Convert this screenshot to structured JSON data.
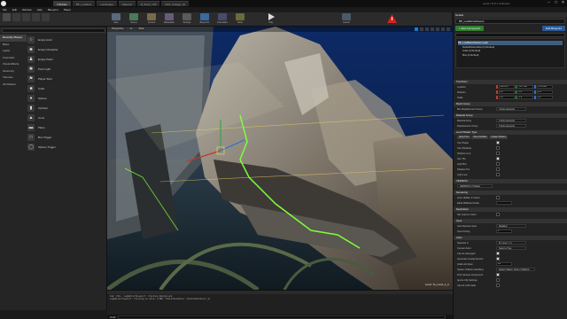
{
  "window": {
    "tabs": [
      "CiffyMap",
      "BP_LostRuin",
      "Landscape",
      "Material",
      "M_Rock_Cliff",
      "MAT_Foliage_02"
    ],
    "title": "Level | TLV x Unknown",
    "controls": [
      "–",
      "□",
      "✕"
    ]
  },
  "menu": [
    "File",
    "Edit",
    "Window",
    "Help",
    "Blueprint",
    "Player"
  ],
  "toolbar": {
    "labels": [
      "Save",
      "Source",
      "Content",
      "Marketplace",
      "Settings",
      "Blueprints",
      "Cinematics",
      "Build",
      "Play",
      "Launch"
    ],
    "accent": "#1f7acb",
    "warning_color": "#d42020"
  },
  "modes": {
    "categories": [
      "Recently Placed",
      "Basic",
      "Lights",
      "Cinematic",
      "Visual Effects",
      "Geometry",
      "Volumes",
      "All Classes"
    ],
    "active_category_index": 0,
    "items": [
      "Empty Actor",
      "Empty Character",
      "Empty Pawn",
      "Point Light",
      "Player Start",
      "Cube",
      "Sphere",
      "Cylinder",
      "Cone",
      "Plane",
      "Box Trigger",
      "Sphere Trigger"
    ]
  },
  "viewport": {
    "top_chips": [
      "Perspective",
      "Lit",
      "Show"
    ],
    "level_label": "Level: SI_Level_1_b"
  },
  "content_browser": {
    "log_lines": [
      "Cmd: FILL…   LogEditorViewport: Clicking Background",
      "LogEditorViewport: Clicking on Actor (LMB): StaticMeshActor (StaticMeshActor_1)"
    ],
    "cmd_label": "Cmd"
  },
  "details": {
    "tab_label": "Details",
    "selected_name": "BP_LostRuinsTowers",
    "add_component": "+ Add Component",
    "edit_blueprint": "Edit Blueprint",
    "components": [
      {
        "label": "BP_LostRuinsTowers (self)",
        "selected": true,
        "indent": false
      },
      {
        "label": "DefaultSceneRoot (Inherited)",
        "selected": false,
        "indent": true
      },
      {
        "label": "Cube (Inherited)",
        "selected": false,
        "indent": true
      },
      {
        "label": "Box (Inherited)",
        "selected": false,
        "indent": true
      }
    ],
    "transform": {
      "header": "Transform",
      "rows": [
        {
          "label": "Location",
          "x": "1026.437",
          "y": "1157.907",
          "z": "1730.000"
        },
        {
          "label": "Rotation",
          "x": "0.0°",
          "y": "0.0°",
          "z": "0.0°"
        },
        {
          "label": "Scale",
          "x": "1.0",
          "y": "1.0",
          "z": "1.0"
        }
      ]
    },
    "sections": [
      {
        "header": "Mesh Group",
        "rows": [
          {
            "label": "Box Replacement Group",
            "value": "3 Array elements"
          }
        ]
      },
      {
        "header": "Material Group",
        "rows": [
          {
            "label": "Material Array",
            "value": "4 Array elements"
          },
          {
            "label": "Replacement Group",
            "value": "3 Array elements"
          }
        ]
      }
    ],
    "lighting": {
      "header": "Level Shader Type",
      "buttons": [
        "Apply Pixel",
        "Reset Defaults",
        "Update Shaders"
      ],
      "rows": [
        "Use Shape",
        "Use Shadows",
        "Shadow Lerp",
        "Gen Tile",
        "Light Box",
        "Shadow Tex",
        "Light Lerp"
      ]
    },
    "status": {
      "header": "VERSION",
      "value": "VERSION 6.3 Shader"
    },
    "rendering": {
      "header": "Rendering",
      "rows": [
        "Actor Hidden In Game",
        "Editor Billboard Scale"
      ]
    },
    "replication": {
      "header": "Replication",
      "rows": [
        "Net Load on Client"
      ]
    },
    "input": {
      "header": "Input",
      "rows": [
        {
          "label": "Auto Receive Input",
          "value": "Disabled"
        },
        {
          "label": "Input Priority",
          "value": "0"
        }
      ]
    },
    "actor": {
      "header": "Actor",
      "rows": [
        {
          "label": "Selected in",
          "value": "SI_Level_1_b"
        },
        {
          "label": "Convert Actor",
          "value": "Select a Type"
        },
        {
          "label": "Can be Damaged",
          "value": ""
        },
        {
          "label": "Generate Overlap Events",
          "value": ""
        },
        {
          "label": "Initial Life Span",
          "value": "0.0"
        },
        {
          "label": "Spawn Collision Handling",
          "value": "Always Spawn, Ignore Collisions"
        },
        {
          "label": "Find Camera Component",
          "value": ""
        },
        {
          "label": "Ignore Clip Settings",
          "value": ""
        },
        {
          "label": "Use for LOD Fade",
          "value": ""
        }
      ]
    }
  }
}
